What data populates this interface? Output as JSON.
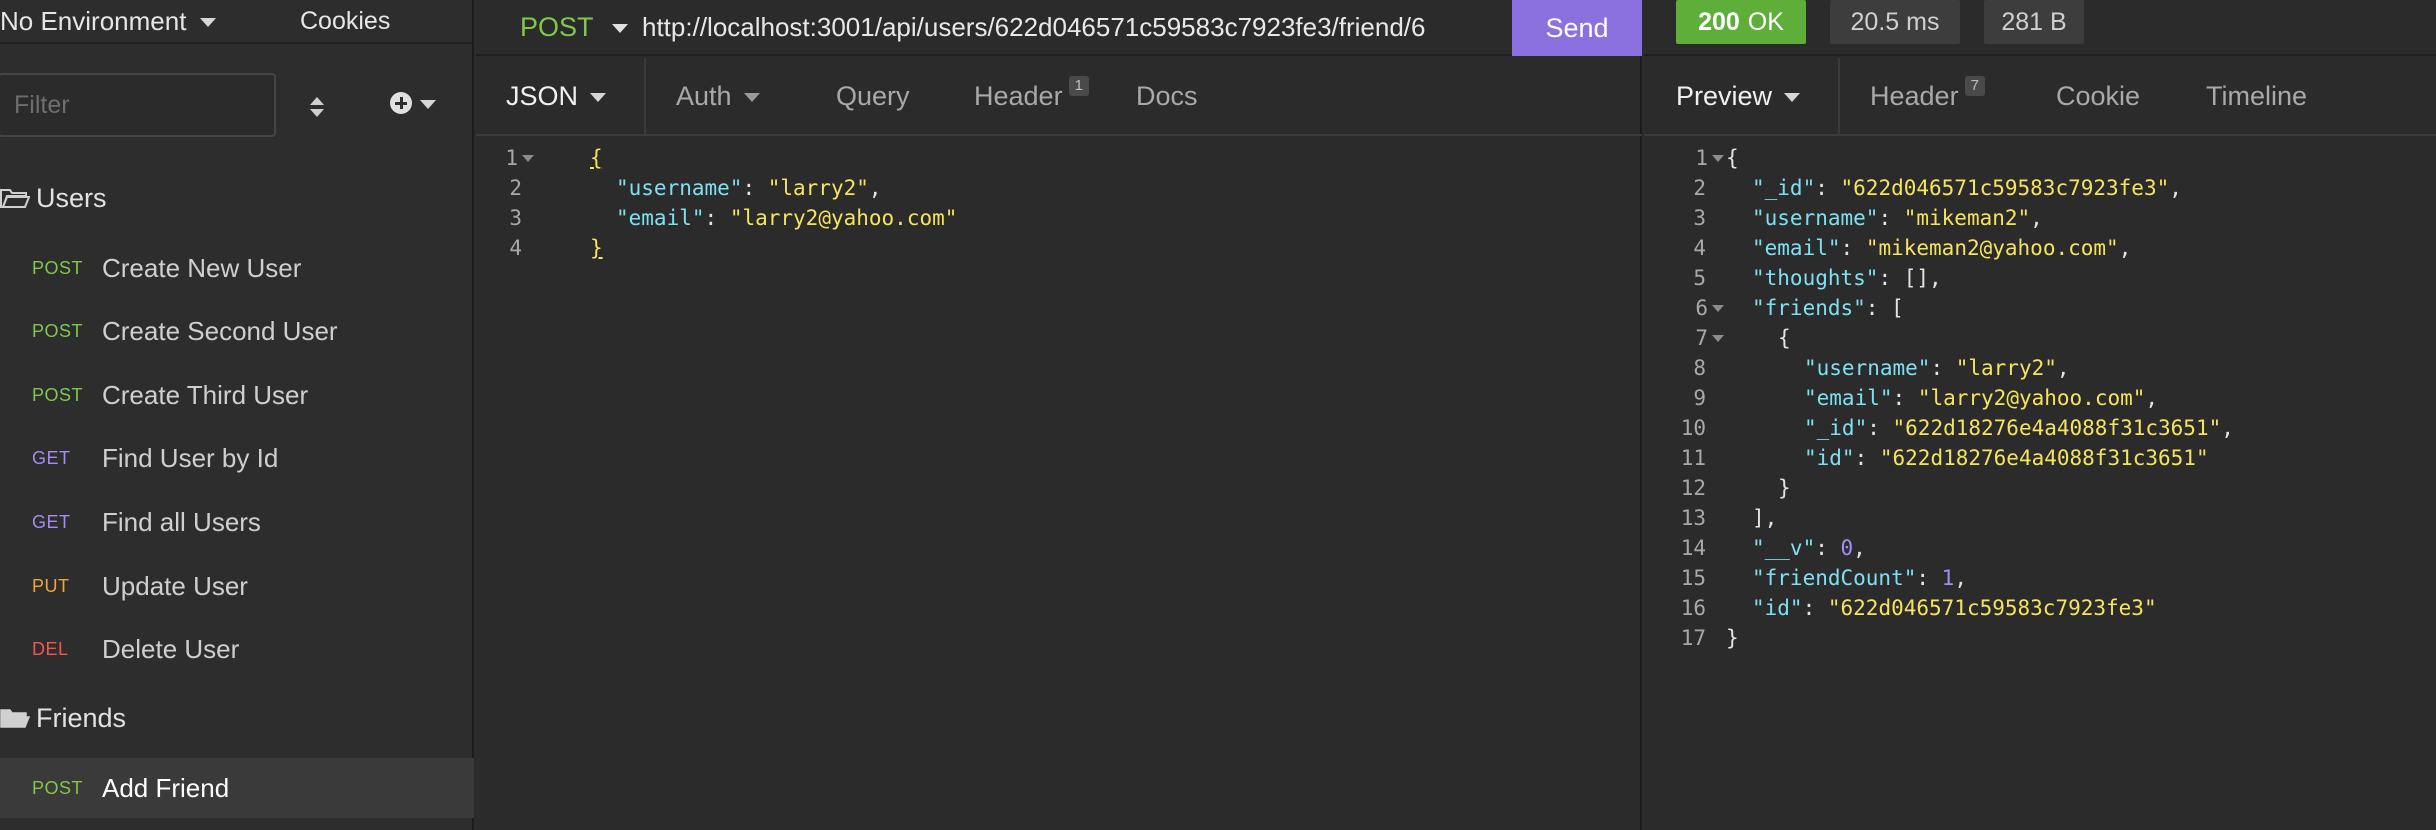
{
  "sidebar": {
    "environment": "No Environment",
    "cookies_label": "Cookies",
    "filter_placeholder": "Filter",
    "folders": [
      {
        "name": "Users"
      },
      {
        "name": "Friends"
      }
    ],
    "requests": [
      {
        "method": "POST",
        "name": "Create New User"
      },
      {
        "method": "POST",
        "name": "Create Second User"
      },
      {
        "method": "POST",
        "name": "Create Third User"
      },
      {
        "method": "GET",
        "name": "Find User by Id"
      },
      {
        "method": "GET",
        "name": "Find all Users"
      },
      {
        "method": "PUT",
        "name": "Update User"
      },
      {
        "method": "DEL",
        "name": "Delete User"
      },
      {
        "method": "POST",
        "name": "Add Friend"
      }
    ]
  },
  "request": {
    "method": "POST",
    "url": "http://localhost:3001/api/users/622d046571c59583c7923fe3/friend/6",
    "send_label": "Send",
    "tabs": [
      {
        "label": "JSON"
      },
      {
        "label": "Auth"
      },
      {
        "label": "Query"
      },
      {
        "label": "Header",
        "badge": "1"
      },
      {
        "label": "Docs"
      }
    ],
    "line_numbers": [
      "1",
      "2",
      "3",
      "4"
    ],
    "body": {
      "username_key": "\"username\"",
      "username_val": "\"larry2\"",
      "email_key": "\"email\"",
      "email_val": "\"larry2@yahoo.com\""
    }
  },
  "response": {
    "status_code": "200",
    "status_text": "OK",
    "time": "20.5 ms",
    "size": "281 B",
    "tabs": [
      {
        "label": "Preview"
      },
      {
        "label": "Header",
        "badge": "7"
      },
      {
        "label": "Cookie"
      },
      {
        "label": "Timeline"
      }
    ],
    "line_numbers": [
      "1",
      "2",
      "3",
      "4",
      "5",
      "6",
      "7",
      "8",
      "9",
      "10",
      "11",
      "12",
      "13",
      "14",
      "15",
      "16",
      "17"
    ],
    "body": {
      "id_key": "\"_id\"",
      "id_val": "\"622d046571c59583c7923fe3\"",
      "username_key": "\"username\"",
      "username_val": "\"mikeman2\"",
      "email_key": "\"email\"",
      "email_val": "\"mikeman2@yahoo.com\"",
      "thoughts_key": "\"thoughts\"",
      "thoughts_val": "[]",
      "friends_key": "\"friends\"",
      "friend_username_key": "\"username\"",
      "friend_username_val": "\"larry2\"",
      "friend_email_key": "\"email\"",
      "friend_email_val": "\"larry2@yahoo.com\"",
      "friend_id_key": "\"_id\"",
      "friend_id_val": "\"622d18276e4a4088f31c3651\"",
      "friend_id2_key": "\"id\"",
      "friend_id2_val": "\"622d18276e4a4088f31c3651\"",
      "v_key": "\"__v\"",
      "v_val": "0",
      "friendcount_key": "\"friendCount\"",
      "friendcount_val": "1",
      "id2_key": "\"id\"",
      "id2_val": "\"622d046571c59583c7923fe3\""
    }
  },
  "colors": {
    "post": "#7fc84b",
    "get": "#a68bf0",
    "put": "#f1a43a",
    "del": "#f0584a",
    "send": "#8b71e0",
    "status_ok": "#5fae3a"
  }
}
